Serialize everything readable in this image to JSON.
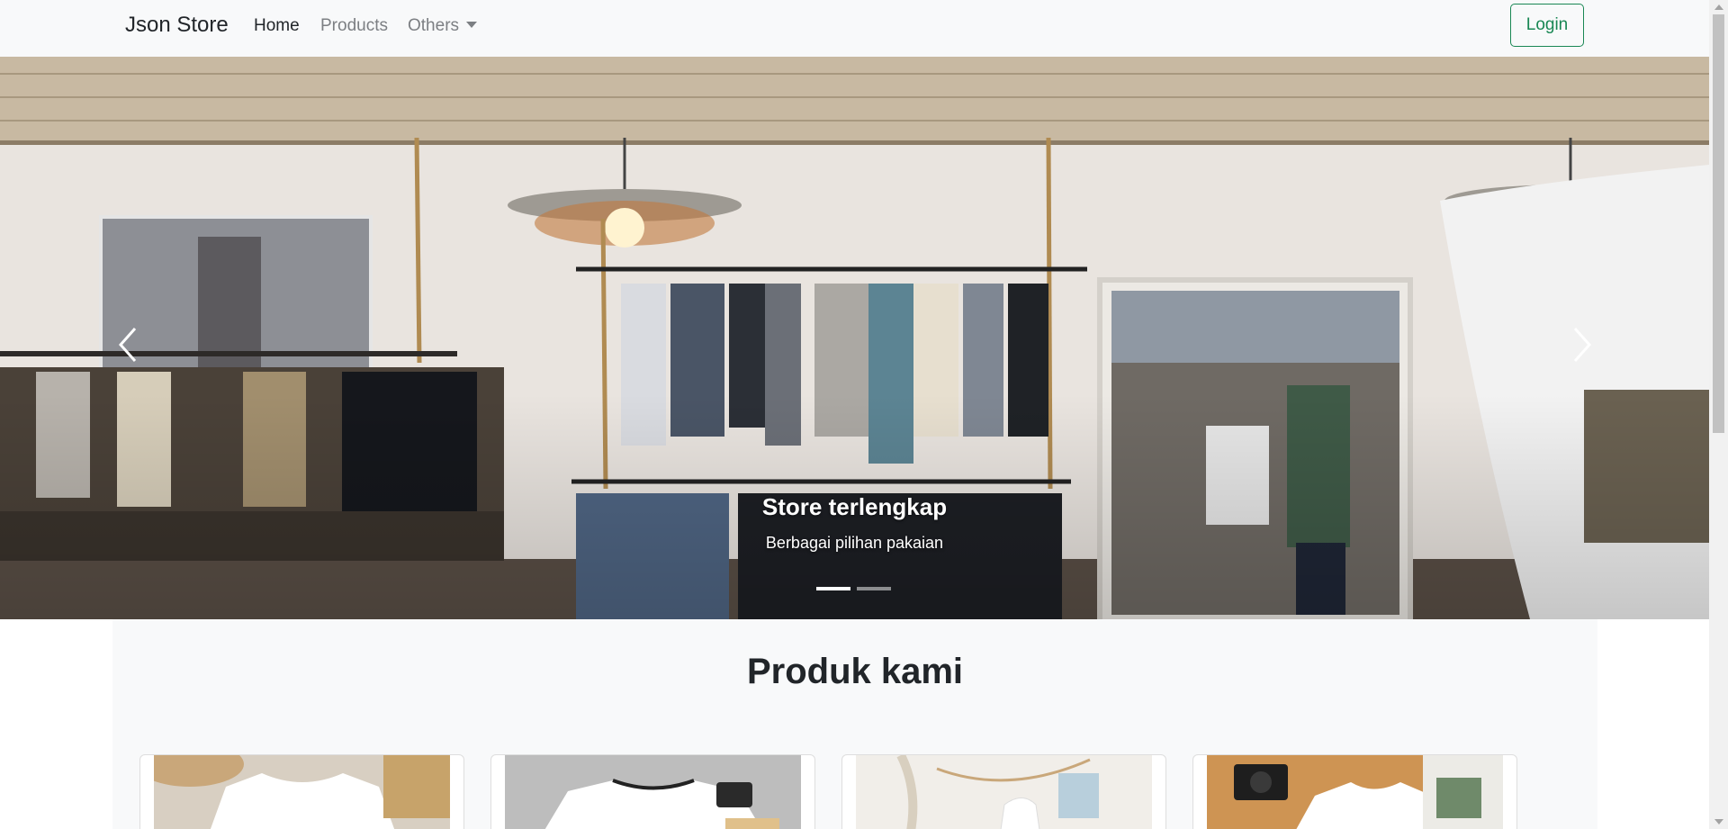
{
  "navbar": {
    "brand": "Json Store",
    "links": [
      {
        "label": "Home",
        "active": true
      },
      {
        "label": "Products",
        "active": false
      },
      {
        "label": "Others",
        "active": false,
        "dropdown": true
      }
    ],
    "login_label": "Login"
  },
  "hero": {
    "slide_title": "Store terlengkap",
    "slide_text": "Berbagai pilihan pakaian",
    "controls": {
      "prev_icon": "chevron-left-icon",
      "next_icon": "chevron-right-icon"
    },
    "indicators": {
      "count": 2,
      "active_index": 0
    }
  },
  "products": {
    "heading": "Produk kami",
    "cards": [
      {
        "image_icon": "white-tshirt-flatlay-icon"
      },
      {
        "image_icon": "white-tshirt-camera-icon"
      },
      {
        "image_icon": "hanging-clothes-icon"
      },
      {
        "image_icon": "tshirt-camera-magazine-icon"
      }
    ]
  },
  "colors": {
    "navbar_bg": "#f8f9fa",
    "login_accent": "#198754",
    "section_bg": "#f8f9fa",
    "text_dark": "#212529",
    "nav_muted": "#7c7f83"
  }
}
